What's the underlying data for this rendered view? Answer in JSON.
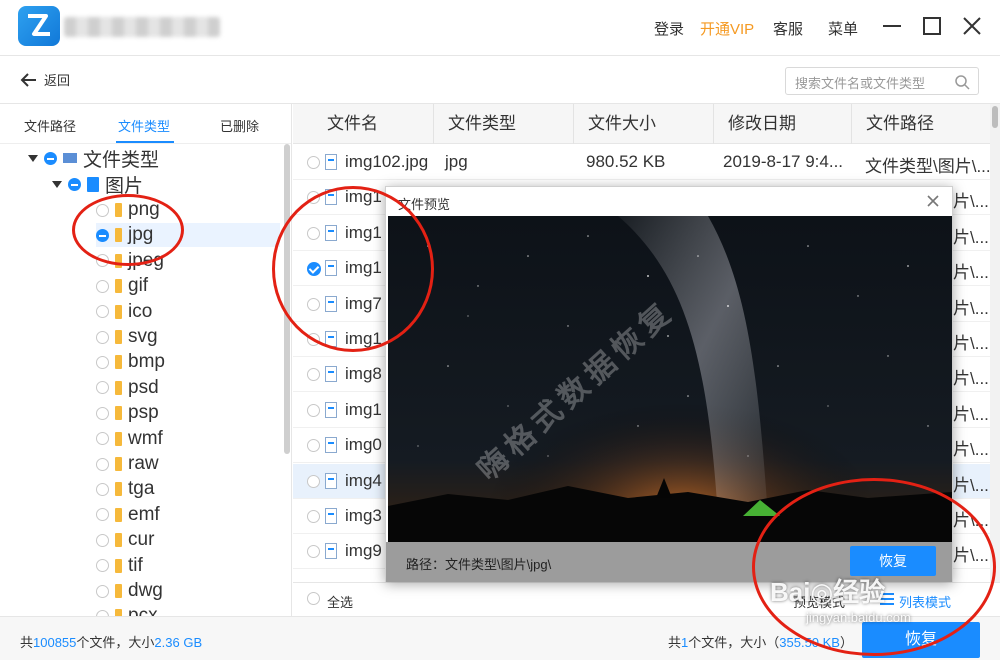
{
  "titlebar": {
    "login": "登录",
    "vip": "开通VIP",
    "service": "客服",
    "menu": "菜单"
  },
  "nav": {
    "back": "返回",
    "search_placeholder": "搜索文件名或文件类型"
  },
  "left_tabs": [
    "文件路径",
    "文件类型",
    "已删除"
  ],
  "tree": [
    {
      "label": "文件类型",
      "level": "root"
    },
    {
      "label": "图片",
      "level": "category"
    },
    {
      "label": "png"
    },
    {
      "label": "jpg"
    },
    {
      "label": "jpeg"
    },
    {
      "label": "gif"
    },
    {
      "label": "ico"
    },
    {
      "label": "svg"
    },
    {
      "label": "bmp"
    },
    {
      "label": "psd"
    },
    {
      "label": "psp"
    },
    {
      "label": "wmf"
    },
    {
      "label": "raw"
    },
    {
      "label": "tga"
    },
    {
      "label": "emf"
    },
    {
      "label": "cur"
    },
    {
      "label": "tif"
    },
    {
      "label": "dwg"
    },
    {
      "label": "pcx"
    }
  ],
  "table": {
    "columns": [
      "文件名",
      "文件类型",
      "文件大小",
      "修改日期",
      "文件路径"
    ],
    "rows": [
      {
        "name": "img102.jpg",
        "type": "jpg",
        "size": "980.52 KB",
        "date": "2019-8-17 9:4...",
        "path": "文件类型\\图片\\..."
      },
      {
        "name": "img1",
        "path_tail": "片\\..."
      },
      {
        "name": "img1",
        "path_tail": "片\\..."
      },
      {
        "name": "img1",
        "path_tail": "片\\...",
        "checked": true
      },
      {
        "name": "img7",
        "path_tail": "片\\..."
      },
      {
        "name": "img1",
        "path_tail": "片\\..."
      },
      {
        "name": "img8",
        "path_tail": "片\\..."
      },
      {
        "name": "img1",
        "path_tail": "片\\..."
      },
      {
        "name": "img0",
        "path_tail": "片\\..."
      },
      {
        "name": "img4",
        "path_tail": "片\\...",
        "highlighted": true
      },
      {
        "name": "img3",
        "path_tail": "片\\..."
      },
      {
        "name": "img9",
        "path_tail": "片\\..."
      }
    ]
  },
  "footer": {
    "select_all": "全选",
    "mode_left": "预览模式",
    "mode_right": "列表模式"
  },
  "status": {
    "total_prefix": "共",
    "total_count": "100855",
    "total_mid": "个文件，大小",
    "total_size": "2.36 GB",
    "sel_prefix": "共",
    "sel_count": "1",
    "sel_mid": "个文件，大小（",
    "sel_size": "355.50 KB",
    "sel_suffix": "）",
    "recover": "恢复"
  },
  "preview": {
    "title": "文件预览",
    "path_label": "路径：",
    "path_value": "文件类型\\图片\\jpg\\",
    "recover": "恢复",
    "watermark": "嗨格式数据恢复"
  },
  "watermark": {
    "baidu": "Bai◎经验",
    "url": "jingyan.baidu.com"
  },
  "colors": {
    "accent": "#1a8cff",
    "vip": "#f59a23",
    "annotation": "#e32114"
  }
}
